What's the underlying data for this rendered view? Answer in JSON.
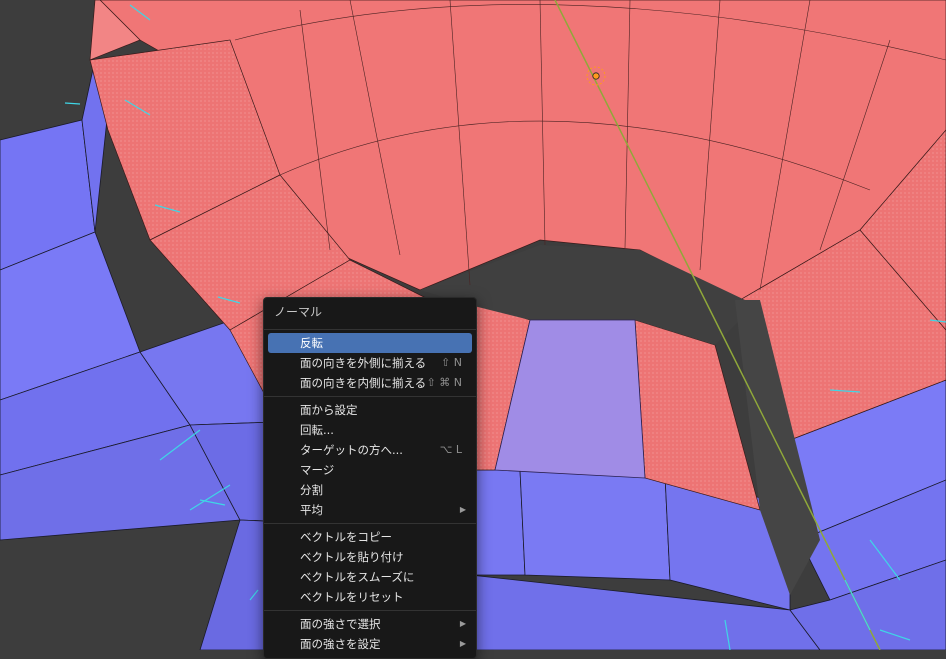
{
  "context_menu": {
    "title": "ノーマル",
    "groups": [
      [
        {
          "label": "反転",
          "shortcut": "",
          "submenu": false,
          "active": true
        },
        {
          "label": "面の向きを外側に揃える",
          "shortcut": "⇧ N",
          "submenu": false,
          "active": false
        },
        {
          "label": "面の向きを内側に揃える",
          "shortcut": "⇧ ⌘ N",
          "submenu": false,
          "active": false
        }
      ],
      [
        {
          "label": "面から設定",
          "shortcut": "",
          "submenu": false,
          "active": false
        },
        {
          "label": "回転...",
          "shortcut": "",
          "submenu": false,
          "active": false
        },
        {
          "label": "ターゲットの方へ...",
          "shortcut": "⌥ L",
          "submenu": false,
          "active": false
        },
        {
          "label": "マージ",
          "shortcut": "",
          "submenu": false,
          "active": false
        },
        {
          "label": "分割",
          "shortcut": "",
          "submenu": false,
          "active": false
        },
        {
          "label": "平均",
          "shortcut": "",
          "submenu": true,
          "active": false
        }
      ],
      [
        {
          "label": "ベクトルをコピー",
          "shortcut": "",
          "submenu": false,
          "active": false
        },
        {
          "label": "ベクトルを貼り付け",
          "shortcut": "",
          "submenu": false,
          "active": false
        },
        {
          "label": "ベクトルをスムーズに",
          "shortcut": "",
          "submenu": false,
          "active": false
        },
        {
          "label": "ベクトルをリセット",
          "shortcut": "",
          "submenu": false,
          "active": false
        }
      ],
      [
        {
          "label": "面の強さで選択",
          "shortcut": "",
          "submenu": true,
          "active": false
        },
        {
          "label": "面の強さを設定",
          "shortcut": "",
          "submenu": true,
          "active": false
        }
      ]
    ]
  },
  "viewport": {
    "colors": {
      "background": "#3d3d3d",
      "face_front": "#7b7bf7",
      "face_back": "#ef7373",
      "selected_face": "#a08ce6",
      "normal_lines": "#3fd6e6",
      "axis_line": "#8fa83a",
      "origin": "#ff9a1e"
    }
  }
}
